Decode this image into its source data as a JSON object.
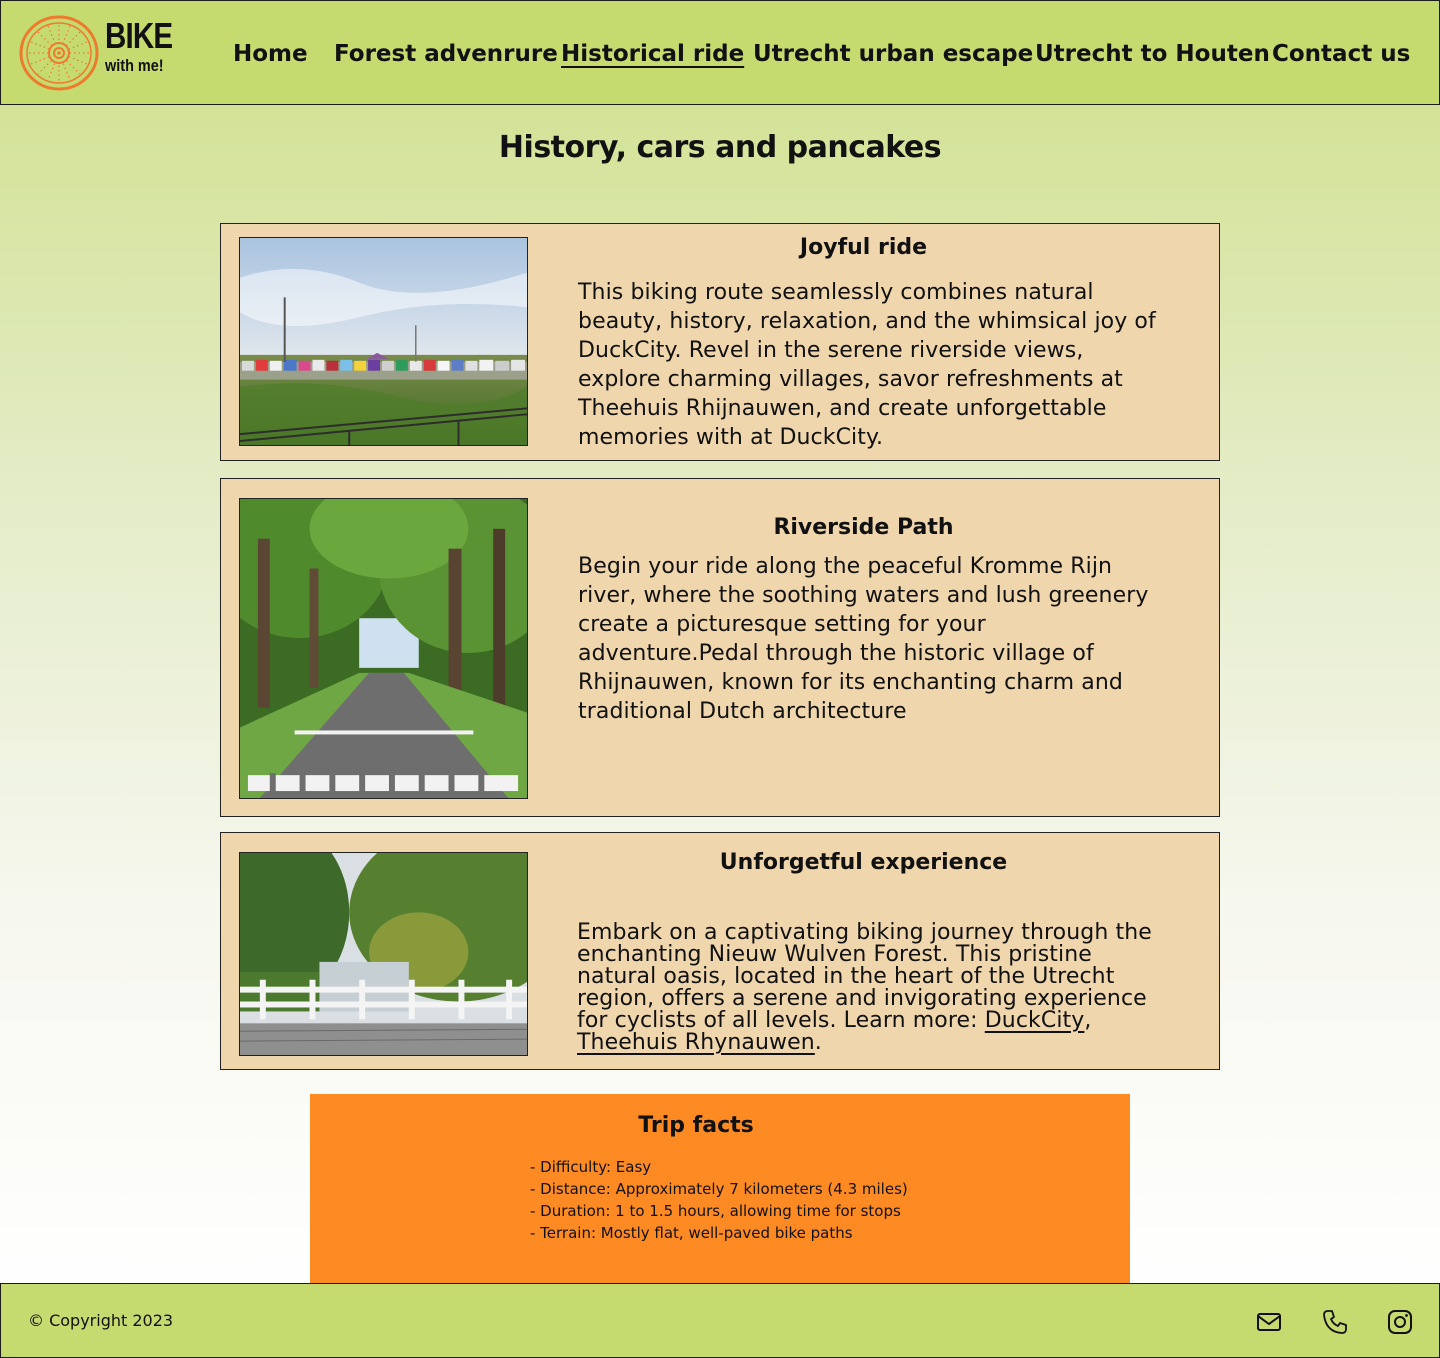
{
  "brand": {
    "line1": "BIKE",
    "line2": "with me!",
    "accent": "#ee7a2e"
  },
  "nav": [
    {
      "label": "Home",
      "active": false
    },
    {
      "label": "Forest advenrure",
      "active": false
    },
    {
      "label": "Historical ride",
      "active": true
    },
    {
      "label": "Utrecht urban escape",
      "active": false
    },
    {
      "label": "Utrecht to Houten",
      "active": false
    },
    {
      "label": "Contact us",
      "active": false
    }
  ],
  "page_title": "History, cars and pancakes",
  "cards": [
    {
      "title": "Joyful ride",
      "text": "This biking route seamlessly combines natural beauty, history, relaxation, and the whimsical joy of DuckCity. Revel in the serene riverside views, explore charming villages, savor refreshments at Theehuis Rhijnauwen, and create unforgettable memories with at DuckCity."
    },
    {
      "title": "Riverside Path",
      "text": "Begin your ride along the peaceful Kromme Rijn river, where the soothing waters and lush greenery create a picturesque setting for your adventure.Pedal through the historic village of Rhijnauwen, known for its enchanting charm and traditional Dutch architecture"
    },
    {
      "title": "Unforgetful experience",
      "text": "Embark on a captivating biking journey through the enchanting Nieuw Wulven Forest. This pristine natural oasis, located in the heart of the Utrecht region, offers a serene and invigorating experience for cyclists of all levels. Learn more: ",
      "link1": "DuckCity",
      "sep": ", ",
      "link2": "Theehuis Rhynauwen",
      "end": "."
    }
  ],
  "facts": {
    "title": "Trip facts",
    "items": [
      "- Difficulty: Easy",
      "- Distance: Approximately 7 kilometers (4.3 miles)",
      "- Duration: 1 to 1.5 hours, allowing time for stops",
      "- Terrain: Mostly flat, well-paved bike paths"
    ]
  },
  "footer": {
    "copyright": "© Copyright 2023",
    "icons": [
      "mail-icon",
      "phone-icon",
      "instagram-icon"
    ]
  },
  "colors": {
    "header_bg": "#c5da6f",
    "card_bg": "#efd6ac",
    "facts_bg": "#fd8a22"
  }
}
